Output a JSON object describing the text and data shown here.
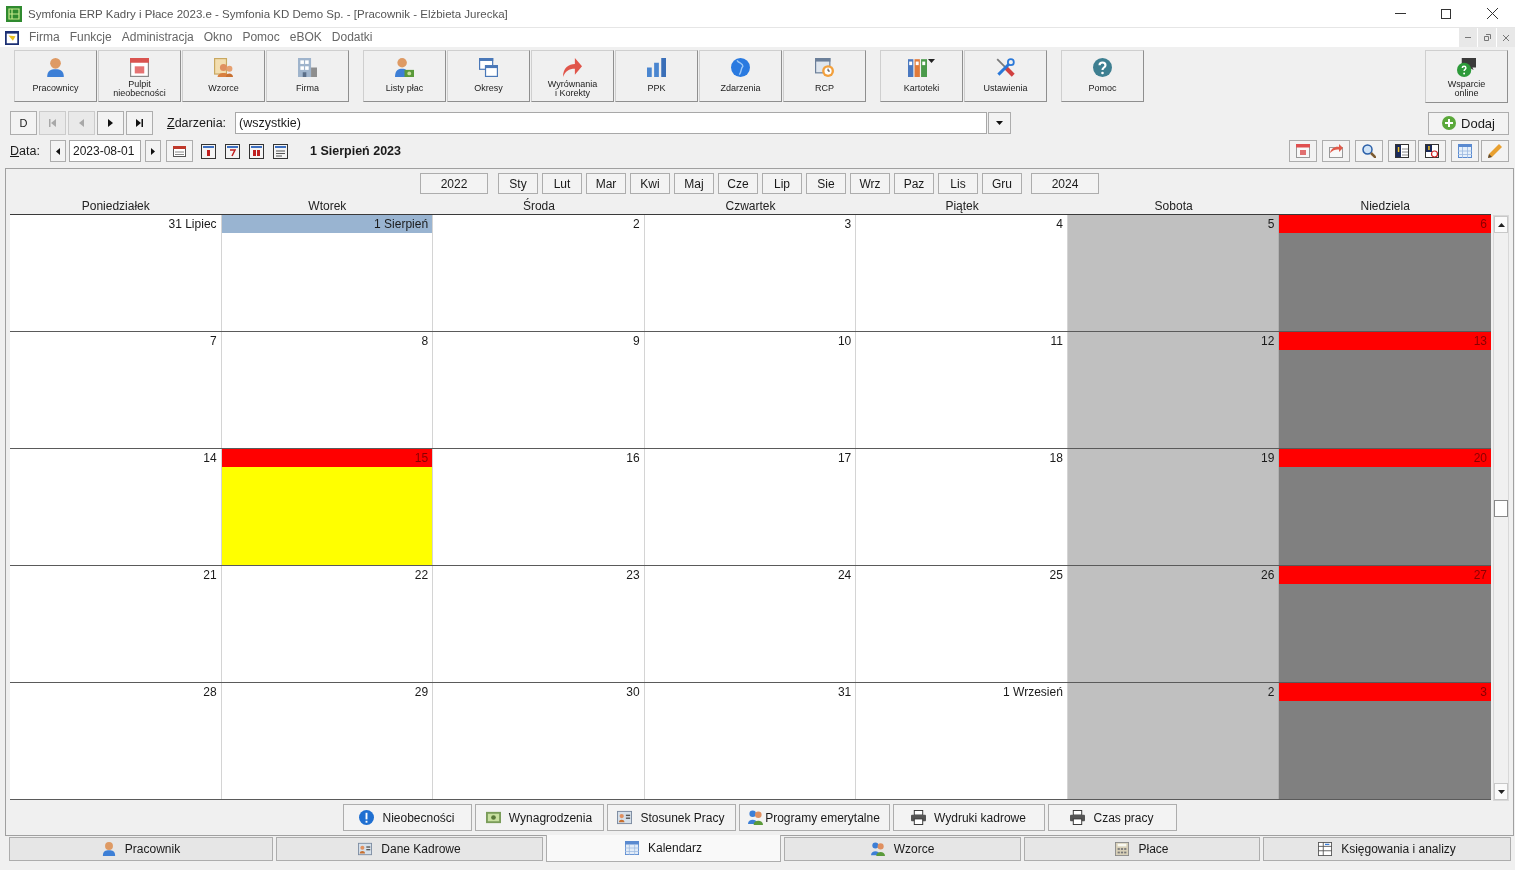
{
  "window": {
    "title": "Symfonia ERP Kadry i Płace 2023.e - Symfonia KD Demo Sp. - [Pracownik - Elżbieta Jurecka]"
  },
  "menu": [
    "Firma",
    "Funkcje",
    "Administracja",
    "Okno",
    "Pomoc",
    "eBOK",
    "Dodatki"
  ],
  "toolbar": {
    "groups": [
      [
        {
          "label": "Pracownicy",
          "dropdown": false
        },
        {
          "label": "Pulpit\nnieobecności",
          "dropdown": false
        },
        {
          "label": "Wzorce",
          "dropdown": false
        },
        {
          "label": "Firma",
          "dropdown": false
        }
      ],
      [
        {
          "label": "Listy płac",
          "dropdown": false
        },
        {
          "label": "Okresy",
          "dropdown": false
        },
        {
          "label": "Wyrównania\ni Korekty",
          "dropdown": false
        },
        {
          "label": "PPK",
          "dropdown": false
        },
        {
          "label": "Zdarzenia",
          "dropdown": false
        },
        {
          "label": "RCP",
          "dropdown": false
        }
      ],
      [
        {
          "label": "Kartoteki",
          "dropdown": true
        },
        {
          "label": "Ustawienia",
          "dropdown": false
        }
      ],
      [
        {
          "label": "Pomoc",
          "dropdown": false
        }
      ]
    ],
    "support": {
      "label": "Wsparcie\nonline"
    }
  },
  "navigator": {
    "buttons": [
      {
        "kind": "text",
        "label": "D",
        "disabled": false
      },
      {
        "kind": "first",
        "disabled": true
      },
      {
        "kind": "prev",
        "disabled": true
      },
      {
        "kind": "next",
        "disabled": false
      },
      {
        "kind": "last",
        "disabled": false
      }
    ]
  },
  "events_filter": {
    "label": "Zdarzenia:",
    "value": "(wszystkie)"
  },
  "add_button": {
    "label": "Dodaj"
  },
  "date": {
    "label": "Data:",
    "value": "2023-08-01"
  },
  "period_title": "1 Sierpień 2023",
  "calendar": {
    "prev_year": "2022",
    "months": [
      "Sty",
      "Lut",
      "Mar",
      "Kwi",
      "Maj",
      "Cze",
      "Lip",
      "Sie",
      "Wrz",
      "Paz",
      "Lis",
      "Gru"
    ],
    "next_year": "2024",
    "weekdays": [
      "Poniedziałek",
      "Wtorek",
      "Środa",
      "Czwartek",
      "Piątek",
      "Sobota",
      "Niedziela"
    ],
    "weeks": [
      [
        {
          "label": "31 Lipiec",
          "kind": "workday",
          "selected": false
        },
        {
          "label": "1 Sierpień",
          "kind": "workday",
          "selected": true
        },
        {
          "label": "2",
          "kind": "workday",
          "selected": false
        },
        {
          "label": "3",
          "kind": "workday",
          "selected": false
        },
        {
          "label": "4",
          "kind": "workday",
          "selected": false
        },
        {
          "label": "5",
          "kind": "saturday",
          "selected": false
        },
        {
          "label": "6",
          "kind": "sunday",
          "selected": false
        }
      ],
      [
        {
          "label": "7",
          "kind": "workday",
          "selected": false
        },
        {
          "label": "8",
          "kind": "workday",
          "selected": false
        },
        {
          "label": "9",
          "kind": "workday",
          "selected": false
        },
        {
          "label": "10",
          "kind": "workday",
          "selected": false
        },
        {
          "label": "11",
          "kind": "workday",
          "selected": false
        },
        {
          "label": "12",
          "kind": "saturday",
          "selected": false
        },
        {
          "label": "13",
          "kind": "sunday",
          "selected": false
        }
      ],
      [
        {
          "label": "14",
          "kind": "workday",
          "selected": false
        },
        {
          "label": "15",
          "kind": "holiday",
          "selected": false
        },
        {
          "label": "16",
          "kind": "workday",
          "selected": false
        },
        {
          "label": "17",
          "kind": "workday",
          "selected": false
        },
        {
          "label": "18",
          "kind": "workday",
          "selected": false
        },
        {
          "label": "19",
          "kind": "saturday",
          "selected": false
        },
        {
          "label": "20",
          "kind": "sunday",
          "selected": false
        }
      ],
      [
        {
          "label": "21",
          "kind": "workday",
          "selected": false
        },
        {
          "label": "22",
          "kind": "workday",
          "selected": false
        },
        {
          "label": "23",
          "kind": "workday",
          "selected": false
        },
        {
          "label": "24",
          "kind": "workday",
          "selected": false
        },
        {
          "label": "25",
          "kind": "workday",
          "selected": false
        },
        {
          "label": "26",
          "kind": "saturday",
          "selected": false
        },
        {
          "label": "27",
          "kind": "sunday",
          "selected": false
        }
      ],
      [
        {
          "label": "28",
          "kind": "workday",
          "selected": false
        },
        {
          "label": "29",
          "kind": "workday",
          "selected": false
        },
        {
          "label": "30",
          "kind": "workday",
          "selected": false
        },
        {
          "label": "31",
          "kind": "workday",
          "selected": false
        },
        {
          "label": "1 Wrzesień",
          "kind": "workday",
          "selected": false
        },
        {
          "label": "2",
          "kind": "saturday",
          "selected": false
        },
        {
          "label": "3",
          "kind": "sunday",
          "selected": false
        }
      ]
    ]
  },
  "section_buttons": [
    "Nieobecności",
    "Wynagrodzenia",
    "Stosunek Pracy",
    "Programy emerytalne",
    "Wydruki kadrowe",
    "Czas pracy"
  ],
  "tabs": [
    {
      "label": "Pracownik",
      "selected": false
    },
    {
      "label": "Dane Kadrowe",
      "selected": false
    },
    {
      "label": "Kalendarz",
      "selected": true
    },
    {
      "label": "Wzorce",
      "selected": false
    },
    {
      "label": "Płace",
      "selected": false
    },
    {
      "label": "Księgowania i analizy",
      "selected": false
    }
  ]
}
